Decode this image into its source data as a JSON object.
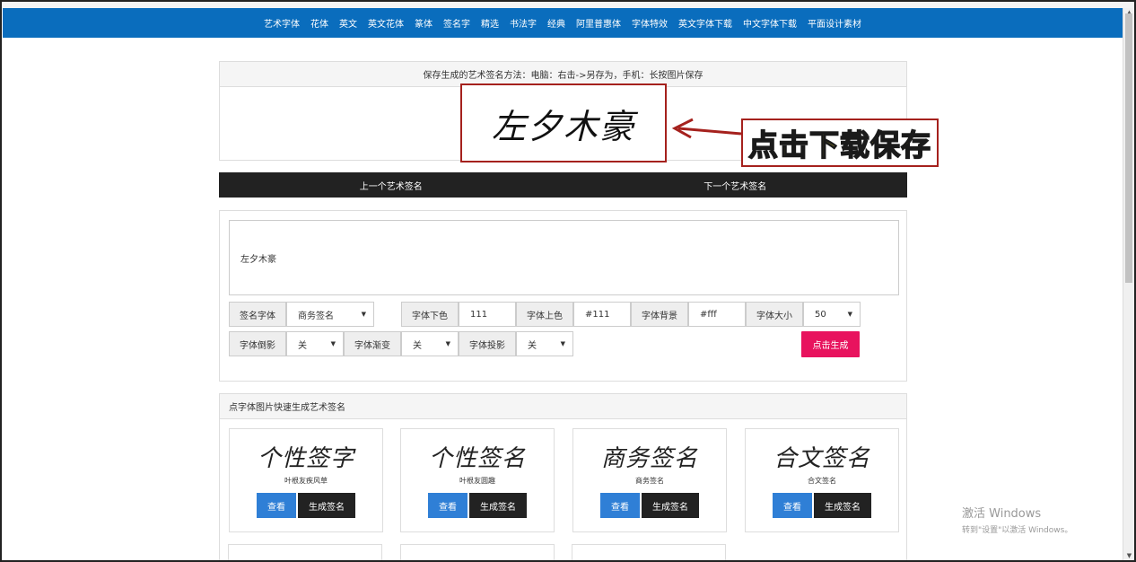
{
  "nav": {
    "links": [
      "艺术字体",
      "花体",
      "英文",
      "英文花体",
      "篆体",
      "签名字",
      "精选",
      "书法字",
      "经典",
      "阿里普惠体",
      "字体特效",
      "英文字体下载",
      "中文字体下载",
      "平面设计素材"
    ],
    "bg_color": "#0a6dbd"
  },
  "preview": {
    "hint": "保存生成的艺术签名方法：电脑：右击->另存为，手机：长按图片保存",
    "signature_text": "左夕木豪"
  },
  "callout": {
    "text": "点击下载保存",
    "text_color": "#ffeb3b",
    "border_color": "#a5211d"
  },
  "pager": {
    "prev": "上一个艺术签名",
    "next": "下一个艺术签名"
  },
  "form": {
    "input_value": "左夕木豪",
    "font_label": "签名字体",
    "font_value": "商务签名",
    "color_low_label": "字体下色",
    "color_low_value": "111",
    "color_high_label": "字体上色",
    "color_high_value": "#111",
    "bg_label": "字体背景",
    "bg_value": "#fff",
    "size_label": "字体大小",
    "size_value": "50",
    "shadow_label": "字体倒影",
    "shadow_value": "关",
    "gradient_label": "字体渐变",
    "gradient_value": "关",
    "projection_label": "字体投影",
    "projection_value": "关",
    "generate_button": "点击生成",
    "accent_color": "#e8135e"
  },
  "fonts_panel": {
    "title": "点字体图片快速生成艺术签名",
    "cards": [
      {
        "preview": "个性签字",
        "name": "叶根友疾风草",
        "view": "查看",
        "generate": "生成签名"
      },
      {
        "preview": "个性签名",
        "name": "叶根友圆趣",
        "view": "查看",
        "generate": "生成签名"
      },
      {
        "preview": "商务签名",
        "name": "商务签名",
        "view": "查看",
        "generate": "生成签名"
      },
      {
        "preview": "合文签名",
        "name": "合文签名",
        "view": "查看",
        "generate": "生成签名"
      }
    ]
  },
  "watermark": {
    "line1": "激活 Windows",
    "line2": "转到\"设置\"以激活 Windows。"
  }
}
